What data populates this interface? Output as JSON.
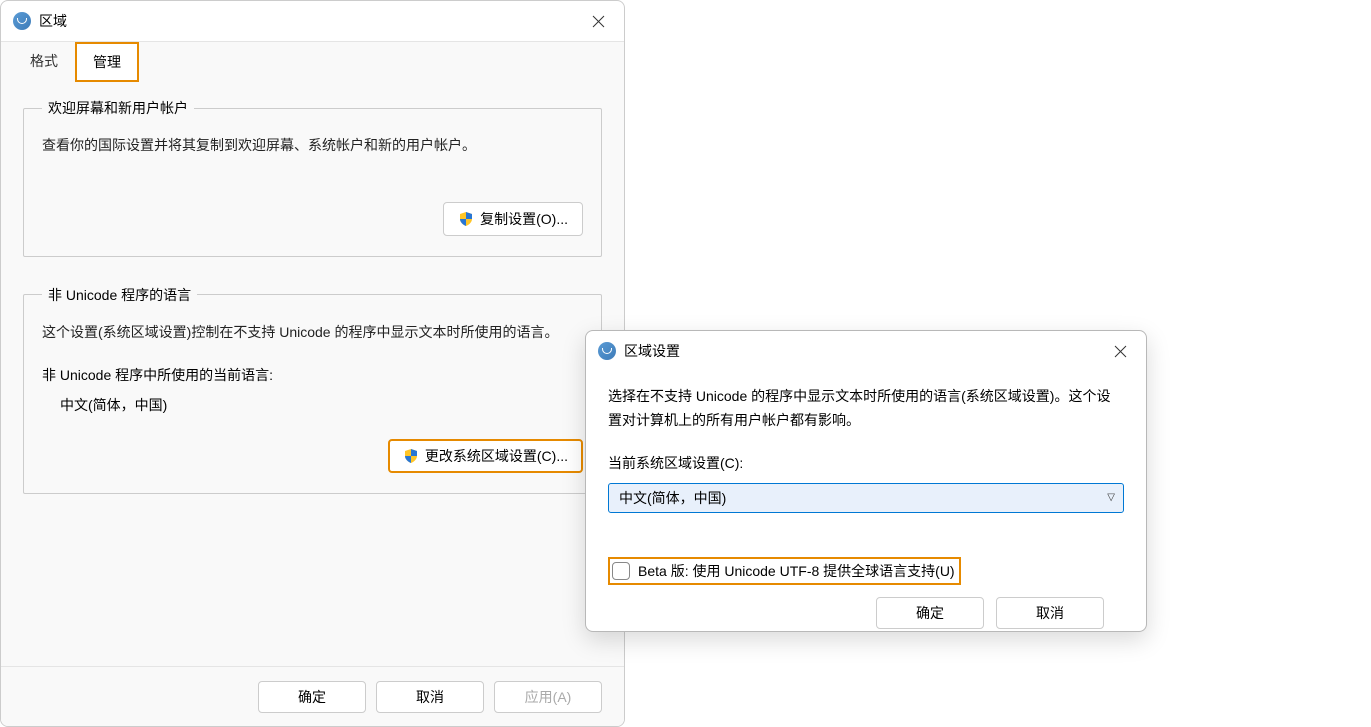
{
  "region_dialog": {
    "title": "区域",
    "tabs": {
      "format": "格式",
      "admin": "管理"
    },
    "welcome_group": {
      "legend": "欢迎屏幕和新用户帐户",
      "desc": "查看你的国际设置并将其复制到欢迎屏幕、系统帐户和新的用户帐户。",
      "copy_btn": "复制设置(O)..."
    },
    "nonunicode_group": {
      "legend": "非 Unicode 程序的语言",
      "desc": "这个设置(系统区域设置)控制在不支持 Unicode 的程序中显示文本时所使用的语言。",
      "current_label": "非 Unicode 程序中所使用的当前语言:",
      "current_value": "中文(简体，中国)",
      "change_btn": "更改系统区域设置(C)..."
    },
    "footer": {
      "ok": "确定",
      "cancel": "取消",
      "apply": "应用(A)"
    }
  },
  "locale_dialog": {
    "title": "区域设置",
    "info": "选择在不支持 Unicode 的程序中显示文本时所使用的语言(系统区域设置)。这个设置对计算机上的所有用户帐户都有影响。",
    "combo_label": "当前系统区域设置(C):",
    "combo_value": "中文(简体，中国)",
    "beta_checkbox": "Beta 版: 使用 Unicode UTF-8 提供全球语言支持(U)",
    "footer": {
      "ok": "确定",
      "cancel": "取消"
    }
  }
}
